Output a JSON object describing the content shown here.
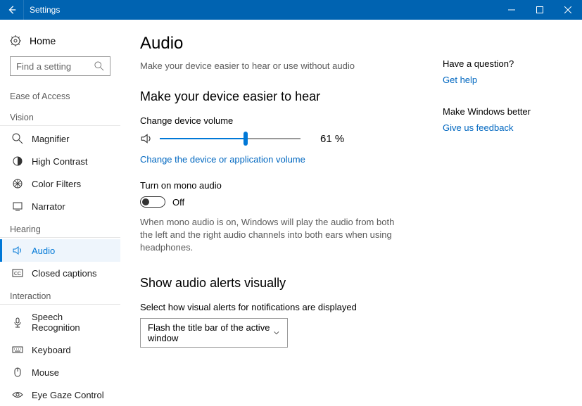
{
  "window": {
    "title": "Settings"
  },
  "sidebar": {
    "home_label": "Home",
    "search_placeholder": "Find a setting",
    "category_label": "Ease of Access",
    "groups": [
      {
        "label": "Vision",
        "items": [
          {
            "label": "Magnifier"
          },
          {
            "label": "High Contrast"
          },
          {
            "label": "Color Filters"
          },
          {
            "label": "Narrator"
          }
        ]
      },
      {
        "label": "Hearing",
        "items": [
          {
            "label": "Audio"
          },
          {
            "label": "Closed captions"
          }
        ]
      },
      {
        "label": "Interaction",
        "items": [
          {
            "label": "Speech Recognition"
          },
          {
            "label": "Keyboard"
          },
          {
            "label": "Mouse"
          },
          {
            "label": "Eye Gaze Control"
          }
        ]
      }
    ]
  },
  "main": {
    "title": "Audio",
    "subtitle": "Make your device easier to hear or use without audio",
    "section1_heading": "Make your device easier to hear",
    "volume_label": "Change device volume",
    "volume_value": "61 %",
    "volume_percent": 61,
    "change_device_link": "Change the device or application volume",
    "mono_label": "Turn on mono audio",
    "mono_state": "Off",
    "mono_description": "When mono audio is on, Windows will play the audio from both the left and the right audio channels into both ears when using headphones.",
    "section2_heading": "Show audio alerts visually",
    "alerts_label": "Select how visual alerts for notifications are displayed",
    "alerts_dropdown_value": "Flash the title bar of the active window"
  },
  "aside": {
    "question_heading": "Have a question?",
    "get_help": "Get help",
    "feedback_heading": "Make Windows better",
    "give_feedback": "Give us feedback"
  }
}
